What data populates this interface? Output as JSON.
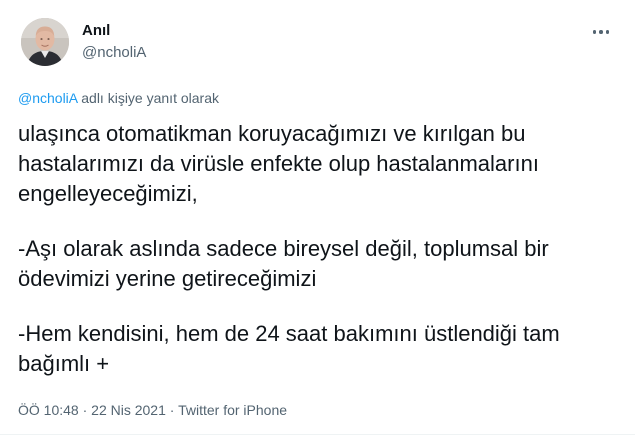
{
  "author": {
    "name": "Anıl",
    "handle": "@ncholiA"
  },
  "reply": {
    "mention": "@ncholiA",
    "suffix": " adlı kişiye yanıt olarak"
  },
  "tweet": {
    "paragraphs": [
      "ulaşınca otomatikman koruyacağımızı ve kırılgan bu hastalarımızı da virüsle enfekte olup hastalanmalarını engelleyeceğimizi,",
      "-Aşı olarak aslında sadece bireysel değil, toplumsal bir ödevimizi yerine getireceğimizi",
      "-Hem kendisini, hem de 24 saat bakımını üstlendiği tam bağımlı +"
    ]
  },
  "meta": {
    "time": "ÖÖ 10:48",
    "separator": " · ",
    "date": "22 Nis 2021",
    "source": "Twitter for iPhone"
  },
  "icons": {
    "more": "more-horizontal-icon"
  }
}
